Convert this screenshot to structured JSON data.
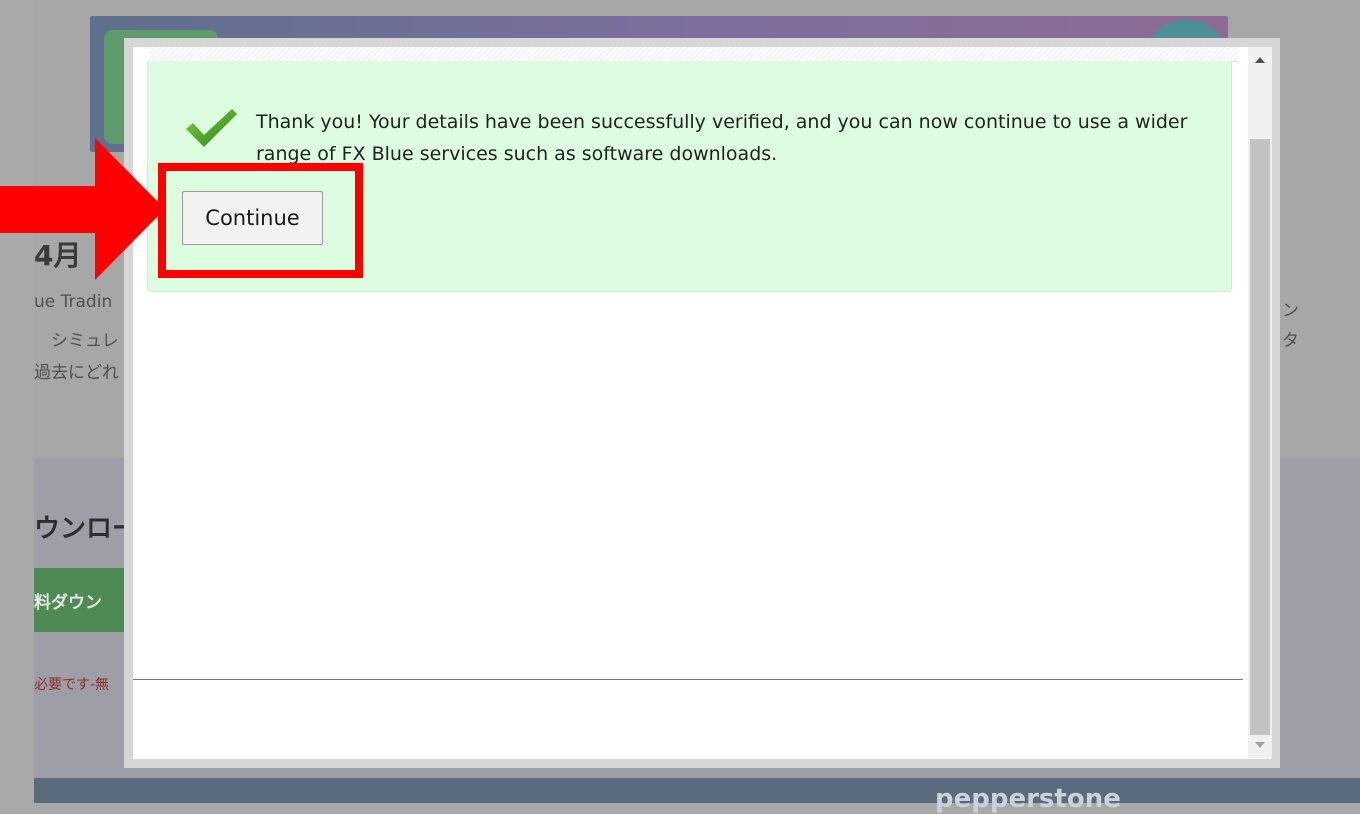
{
  "background": {
    "heading": "4月",
    "text_lines": [
      "ue Tradin",
      "　シミュレ",
      "過去にどれ"
    ],
    "right_chars": [
      "ン",
      "タ"
    ],
    "section_title": "ウンロー",
    "download_button": "料ダウン",
    "note": "必要です-無",
    "footer_brand": "pepperstone"
  },
  "modal": {
    "message": "Thank you! Your details have been successfully verified, and you can now continue to use a wider range of FX Blue services such as software downloads.",
    "continue_label": "Continue",
    "check_icon": "checkmark-icon"
  },
  "colors": {
    "success_bg": "#ddfde0",
    "highlight": "#ff0000",
    "overlay": "#a7a7a7"
  }
}
